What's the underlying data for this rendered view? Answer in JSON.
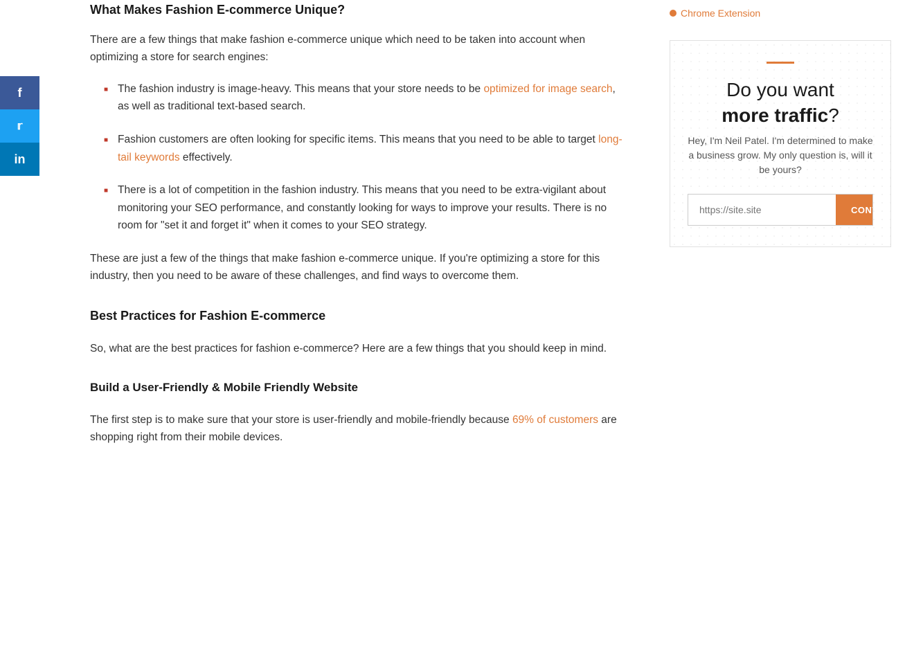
{
  "social": {
    "facebook_label": "f",
    "twitter_label": "t",
    "linkedin_label": "in"
  },
  "header": {
    "chrome_extension_label": "Chrome Extension"
  },
  "content": {
    "section1_heading": "What Makes Fashion E-commerce Unique?",
    "section1_intro": "There are a few things that make fashion e-commerce unique which need to be taken into account when optimizing a store for search engines:",
    "bullet1_text_before": "The fashion industry is image-heavy. This means that your store needs to be ",
    "bullet1_link_text": "optimized for image search",
    "bullet1_text_after": ", as well as traditional text-based search.",
    "bullet2_text_before": "Fashion customers are often looking for specific items. This means that you need to be able to target ",
    "bullet2_link_text": "long-tail keywords",
    "bullet2_text_after": " effectively.",
    "bullet3_text": "There is a lot of competition in the fashion industry. This means that you need to be extra-vigilant about monitoring your SEO performance, and constantly looking for ways to improve your results. There is no room for \"set it and forget it\" when it comes to your SEO strategy.",
    "section1_outro": "These are just a few of the things that make fashion e-commerce unique. If you're optimizing a store for this industry, then you need to be aware of these challenges, and find ways to overcome them.",
    "section2_heading": "Best Practices for Fashion E-commerce",
    "section2_intro": "So, what are the best practices for fashion e-commerce? Here are a few things that you should keep in mind.",
    "section3_heading": "Build a User-Friendly & Mobile Friendly Website",
    "section3_intro_before": "The first step is to make sure that your store is user-friendly and mobile-friendly because ",
    "section3_link_text": "69% of customers",
    "section3_intro_after": " are shopping right from their mobile devices."
  },
  "widget": {
    "headline_part1": "Do you want",
    "headline_bold": "more traffic",
    "headline_part2": "?",
    "subtext": "Hey, I'm Neil Patel. I'm determined to make a business grow. My only question is, will it be yours?",
    "input_placeholder": "https://site.site",
    "button_label": "CONTINUE"
  }
}
